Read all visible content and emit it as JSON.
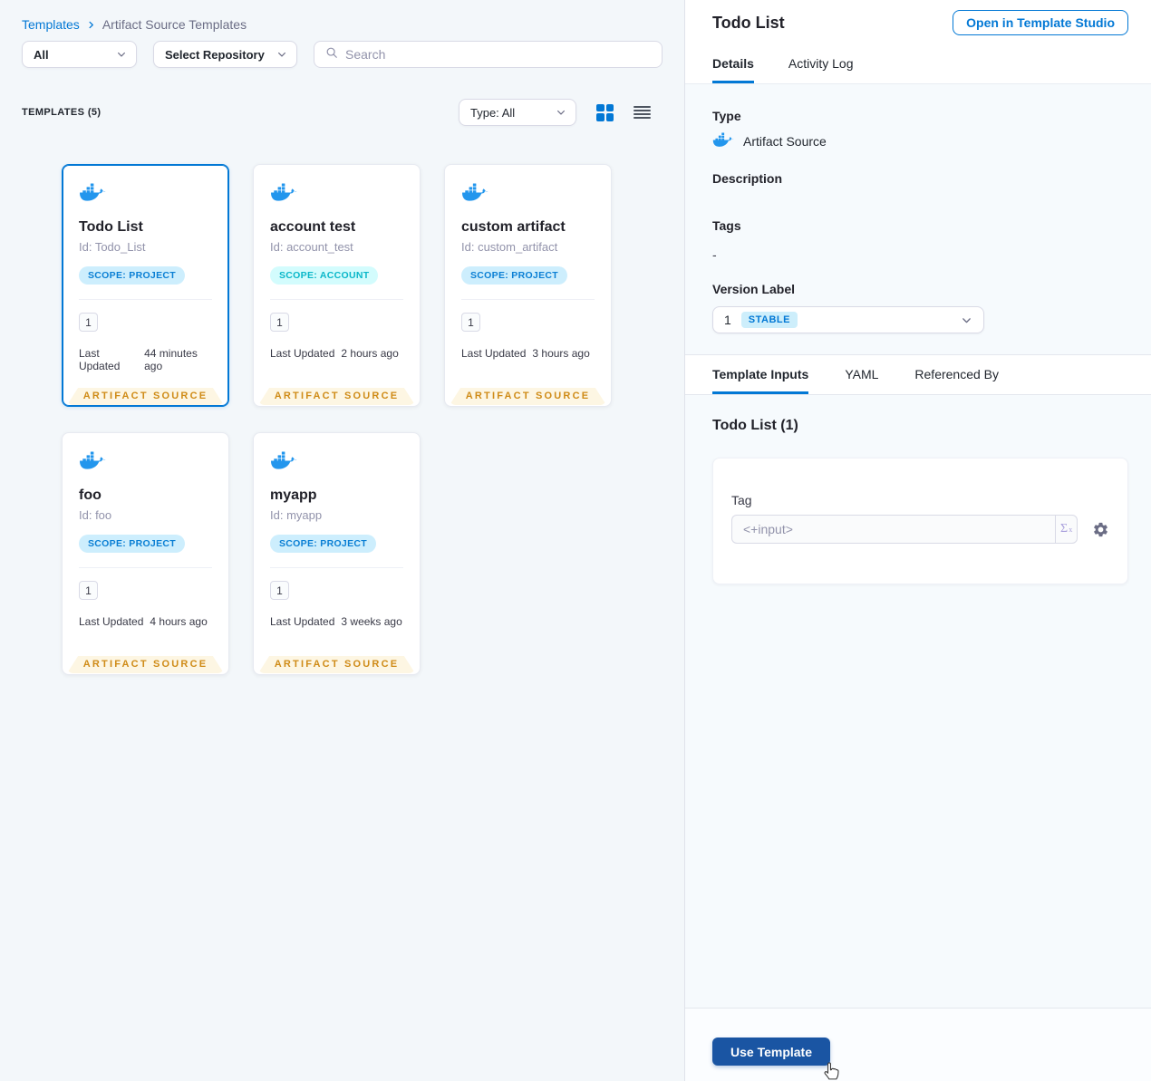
{
  "colors": {
    "primary_blue": "#0278d5",
    "use_template_blue": "#1a55a3",
    "ribbon_orange": "#cf8b17",
    "ribbon_bg": "#fdf6e3",
    "scope_project_bg": "#cdeefd",
    "scope_account_bg": "#d3fcfd",
    "docker_blue": "#2396ed"
  },
  "breadcrumb": {
    "root": "Templates",
    "current": "Artifact Source Templates"
  },
  "filters": {
    "scope_value": "All",
    "repo_value": "Select Repository",
    "search_placeholder": "Search"
  },
  "toolbar": {
    "count_label": "TEMPLATES (5)",
    "type_filter_value": "Type: All"
  },
  "cards": [
    {
      "title": "Todo List",
      "id": "Id: Todo_List",
      "scope": "SCOPE: PROJECT",
      "scope_type": "project",
      "version": "1",
      "updated_label": "Last Updated",
      "updated_value": "44 minutes ago",
      "ribbon": "ARTIFACT SOURCE",
      "selected": true
    },
    {
      "title": "account test",
      "id": "Id: account_test",
      "scope": "SCOPE: ACCOUNT",
      "scope_type": "account",
      "version": "1",
      "updated_label": "Last Updated",
      "updated_value": "2 hours ago",
      "ribbon": "ARTIFACT SOURCE",
      "selected": false
    },
    {
      "title": "custom artifact",
      "id": "Id: custom_artifact",
      "scope": "SCOPE: PROJECT",
      "scope_type": "project",
      "version": "1",
      "updated_label": "Last Updated",
      "updated_value": "3 hours ago",
      "ribbon": "ARTIFACT SOURCE",
      "selected": false
    },
    {
      "title": "foo",
      "id": "Id: foo",
      "scope": "SCOPE: PROJECT",
      "scope_type": "project",
      "version": "1",
      "updated_label": "Last Updated",
      "updated_value": "4 hours ago",
      "ribbon": "ARTIFACT SOURCE",
      "selected": false
    },
    {
      "title": "myapp",
      "id": "Id: myapp",
      "scope": "SCOPE: PROJECT",
      "scope_type": "project",
      "version": "1",
      "updated_label": "Last Updated",
      "updated_value": "3 weeks ago",
      "ribbon": "ARTIFACT SOURCE",
      "selected": false
    }
  ],
  "details": {
    "title": "Todo List",
    "open_studio_label": "Open in Template Studio",
    "tabs": [
      "Details",
      "Activity Log"
    ],
    "type_label": "Type",
    "type_value": "Artifact Source",
    "description_label": "Description",
    "tags_label": "Tags",
    "tags_value": "-",
    "version_label": "Version Label",
    "version_value": "1",
    "version_badge": "STABLE",
    "inputs_tabs": [
      "Template Inputs",
      "YAML",
      "Referenced By"
    ],
    "inputs_title": "Todo List (1)",
    "tag_label": "Tag",
    "tag_value": "<+input>",
    "fx_label": "Σ",
    "use_template_label": "Use Template"
  }
}
